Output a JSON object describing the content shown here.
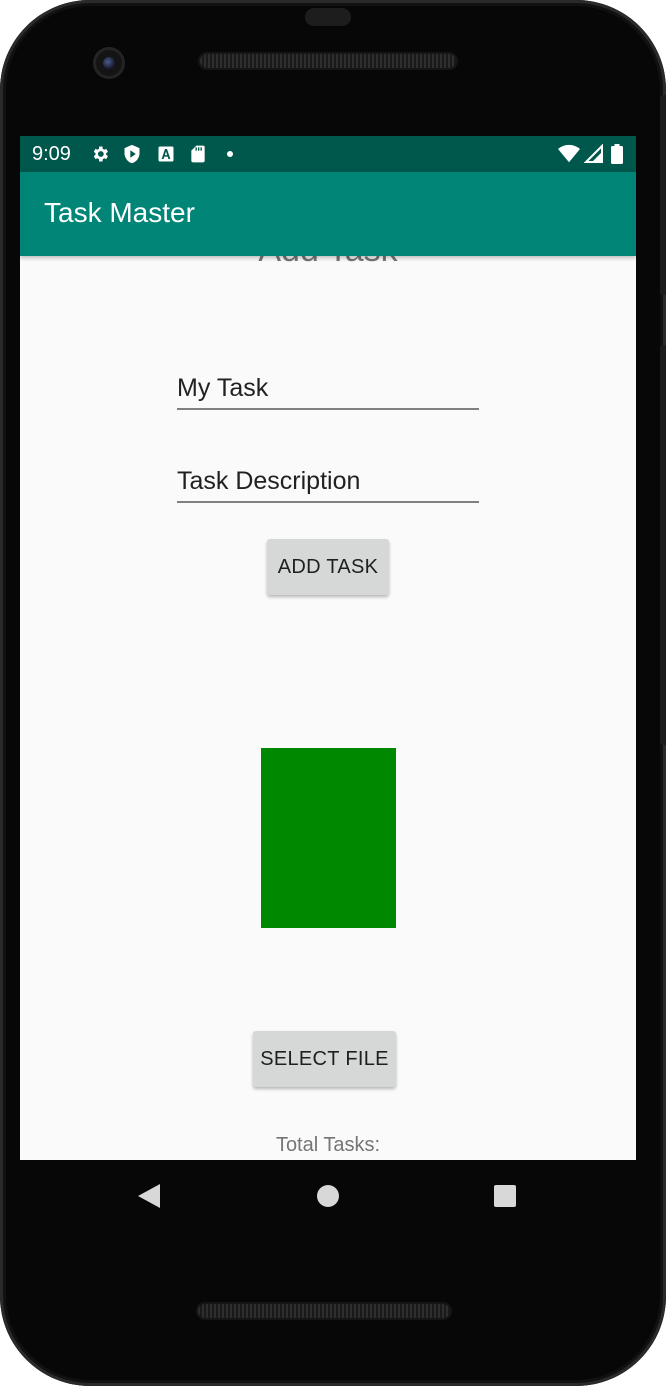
{
  "status_bar": {
    "time": "9:09",
    "left_icons": [
      "gear-icon",
      "play-protect-icon",
      "font-a-icon",
      "sd-card-icon",
      "dot-icon"
    ],
    "right_icons": [
      "wifi-icon",
      "signal-icon",
      "battery-icon"
    ]
  },
  "app_bar": {
    "title": "Task Master"
  },
  "form": {
    "heading": "Add Task",
    "title_value": "My Task",
    "description_value": "Task Description",
    "add_button_label": "ADD TASK",
    "select_file_label": "SELECT FILE",
    "total_tasks_label": "Total Tasks:"
  },
  "image_preview": {
    "color": "#008800"
  },
  "navigation": {
    "buttons": [
      "back-icon",
      "home-icon",
      "recents-icon"
    ]
  },
  "colors": {
    "status_bar": "#00574b",
    "app_bar": "#008577",
    "screen_background": "#fafafa",
    "button_background": "#d6d7d7"
  }
}
